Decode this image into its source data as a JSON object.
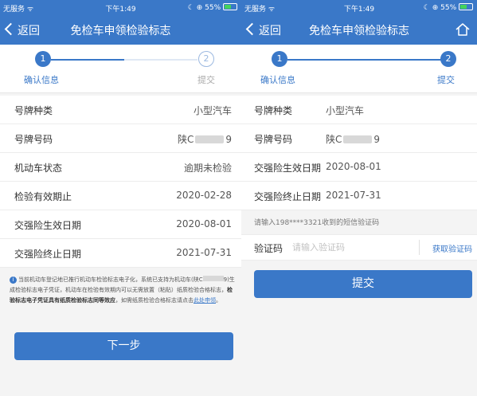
{
  "left": {
    "status": {
      "carrier": "无服务 ᯤ",
      "time": "下午1:49",
      "battery": "☾ ⊕ 55%"
    },
    "nav": {
      "back": "返回",
      "title": "免检车申领检验标志"
    },
    "steps": [
      {
        "num": "1",
        "label": "确认信息"
      },
      {
        "num": "2",
        "label": "提交"
      }
    ],
    "rows": [
      {
        "label": "号牌种类",
        "value": "小型汽车"
      },
      {
        "label": "号牌号码",
        "value_prefix": "陕C",
        "value_suffix": "9"
      },
      {
        "label": "机动车状态",
        "value": "逾期未检验"
      },
      {
        "label": "检验有效期止",
        "value": "2020-02-28"
      },
      {
        "label": "交强险生效日期",
        "value": "2020-08-01"
      },
      {
        "label": "交强险终止日期",
        "value": "2021-07-31"
      }
    ],
    "notice": {
      "p1": "当前机动车登记地已推行机动车检验标志电子化，系统已支持为机动车(陕C",
      "p2": "9)生成检验标志电子凭证，机动车在检验有效期内可以无需放置（粘贴）纸质检验合格标志，",
      "bold": "检验标志电子凭证具有纸质检验标志同等效应",
      "p3": "，如需纸质检验合格标志请点击",
      "link": "此处申领",
      "end": "。"
    },
    "next_button": "下一步"
  },
  "right": {
    "status": {
      "carrier": "无服务 ᯤ",
      "time": "下午1:49",
      "battery": "☾ ⊕ 55%"
    },
    "nav": {
      "back": "返回",
      "title": "免检车申领检验标志"
    },
    "steps": [
      {
        "num": "1",
        "label": "确认信息"
      },
      {
        "num": "2",
        "label": "提交"
      }
    ],
    "rows": [
      {
        "label": "号牌种类",
        "value": "小型汽车"
      },
      {
        "label": "号牌号码",
        "value_prefix": "陕C",
        "value_suffix": "9"
      },
      {
        "label": "交强险生效日期",
        "value": "2020-08-01"
      },
      {
        "label": "交强险终止日期",
        "value": "2021-07-31"
      }
    ],
    "sms_hint": "请输入198****3321收到的短信验证码",
    "code": {
      "label": "验证码",
      "placeholder": "请输入验证码",
      "get": "获取验证码"
    },
    "submit_button": "提交"
  },
  "colors": {
    "primary": "#3a78c8",
    "inactive": "#9bb8e0"
  },
  "icons": [
    "back-chevron-icon",
    "home-icon",
    "info-icon",
    "battery-icon",
    "wifi-icon"
  ]
}
